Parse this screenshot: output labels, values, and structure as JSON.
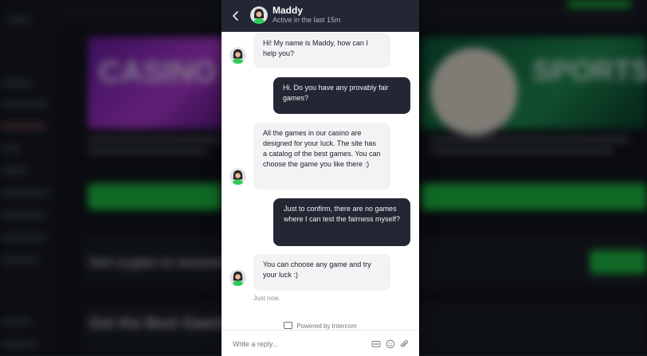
{
  "background": {
    "banner_casino_word": "CASINO",
    "banner_sports_word": "SPORTS",
    "crypto_heading": "Get crypto in seconds",
    "gambling_heading": "Get the Best Gambling",
    "colors": {
      "accent_green": "#1fc046",
      "page_dark": "#12151c"
    }
  },
  "chat": {
    "header": {
      "agent_name": "Maddy",
      "status": "Active in the last 15m",
      "back_icon": "chevron-left-icon"
    },
    "messages": [
      {
        "from": "agent",
        "text": "Hi! My name is Maddy, how can I help you?"
      },
      {
        "from": "user",
        "text": "Hi. Do you have any provably fair games?"
      },
      {
        "from": "agent",
        "text": "All the games in our casino are designed for your luck. The site has a catalog of the best games. You can choose the game you like there :)"
      },
      {
        "from": "user",
        "text": "Just to confirm, there are no games where I can test the fairness myself?"
      },
      {
        "from": "agent",
        "text": "You can choose any game and try your luck :)"
      }
    ],
    "last_timestamp": "Just now.",
    "powered_by": "Powered by Intercom",
    "composer": {
      "placeholder": "Write a reply...",
      "icons": [
        "gif-icon",
        "emoji-icon",
        "paperclip-icon"
      ]
    },
    "colors": {
      "header": "#232733",
      "user_bubble": "#232733",
      "agent_bubble": "#f2f3f5"
    }
  }
}
